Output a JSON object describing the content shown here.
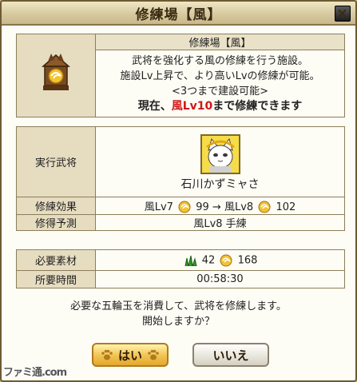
{
  "window": {
    "title": "修練場【風】",
    "close_label": "×"
  },
  "facility": {
    "name": "修練場【風】",
    "desc_lines": [
      "武将を強化する風の修練を行う施設。",
      "施設Lv上昇で、より高いLvの修練が可能。",
      "<3つまで建設可能>"
    ],
    "status_prefix": "現在、",
    "status_level": "風Lv10",
    "status_suffix": "まで修練できます"
  },
  "general": {
    "label": "実行武将",
    "name": "石川かずミャさ"
  },
  "effect": {
    "label": "修練効果",
    "from": "風Lv7",
    "from_value": "99",
    "arrow": "→",
    "to": "風Lv8",
    "to_value": "102"
  },
  "forecast": {
    "label": "修得予測",
    "value": "風Lv8 手練"
  },
  "materials": {
    "label": "必要素材",
    "grass_count": "42",
    "gorin_count": "168"
  },
  "time": {
    "label": "所要時間",
    "value": "00:58:30"
  },
  "confirm": {
    "line1": "必要な五輪玉を消費して、武将を修練します。",
    "line2": "開始しますか？"
  },
  "buttons": {
    "yes": "はい",
    "no": "いいえ"
  },
  "watermark": "ファミ通.com",
  "colors": {
    "accent_red": "#d01818",
    "yes_button": "#f2c250",
    "panel": "#e6dcc0"
  }
}
